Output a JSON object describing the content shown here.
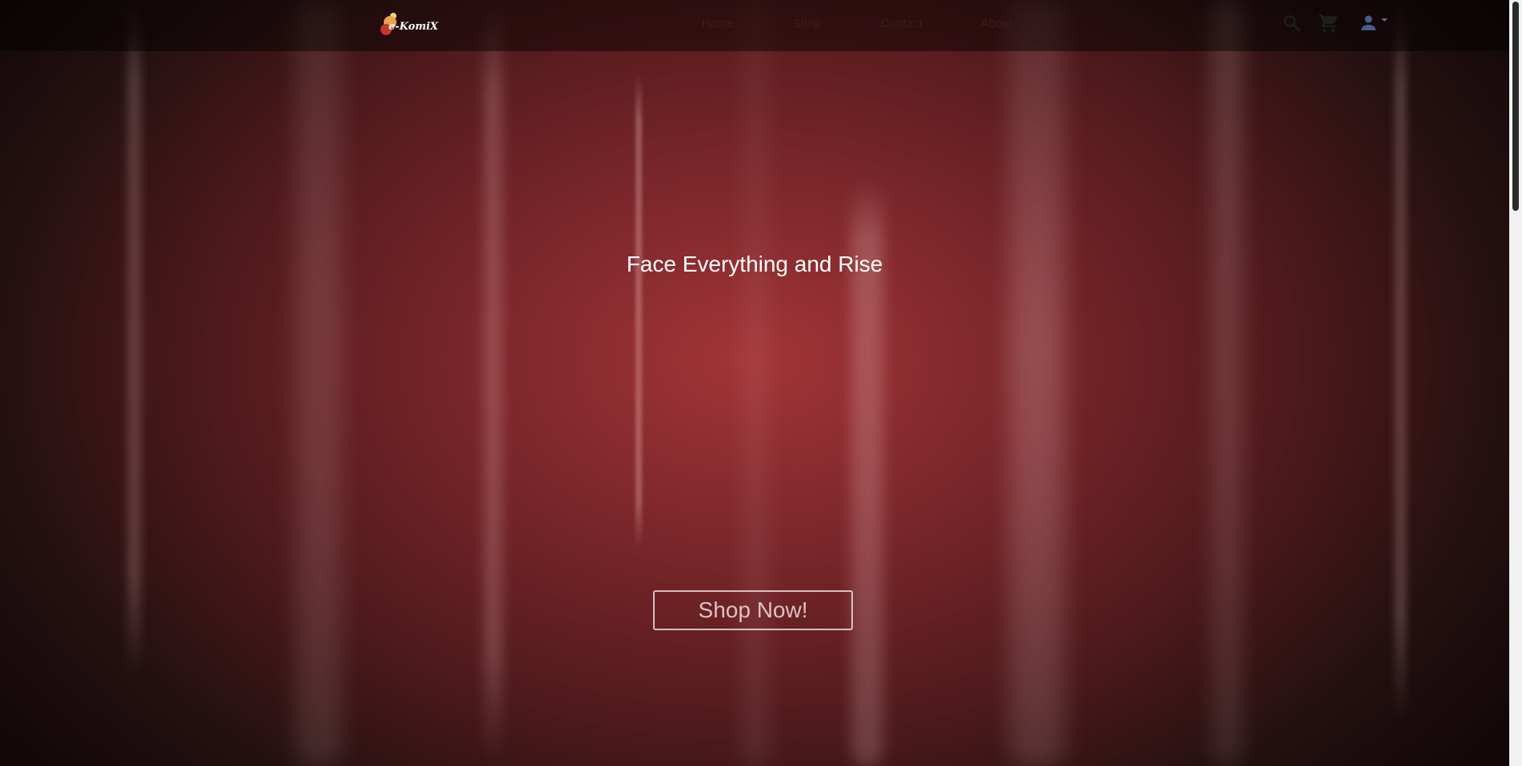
{
  "brand": {
    "logo_text": "e-KomiX"
  },
  "nav": {
    "links": [
      {
        "label": "Home"
      },
      {
        "label": "Shop"
      },
      {
        "label": "Contact"
      },
      {
        "label": "About"
      }
    ]
  },
  "header_icons": {
    "search": "search-icon",
    "cart": "shopping-cart-icon",
    "user": "user-icon",
    "user_dropdown": "caret-down-icon"
  },
  "hero": {
    "title": "Face Everything and Rise",
    "cta_label": "Shop Now!"
  },
  "colors": {
    "hero_center": "#a23538",
    "hero_edge": "#130808",
    "nav_text": "#3a1e1e",
    "icon_dark": "#1e1e1e",
    "user_icon": "#4a5b8a",
    "title_text": "#ffffff"
  }
}
